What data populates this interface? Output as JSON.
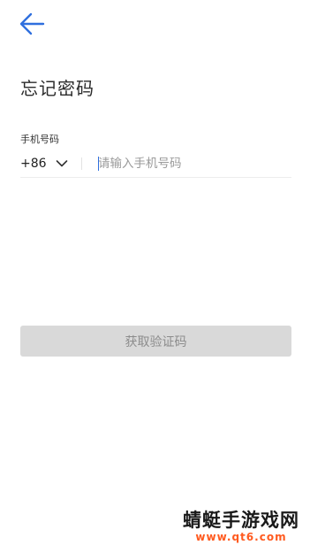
{
  "header": {
    "back_icon": "arrow-left-icon",
    "title": "忘记密码"
  },
  "form": {
    "phone_label": "手机号码",
    "country_code": "+86",
    "country_code_icon": "chevron-down-icon",
    "phone_placeholder": "请输入手机号码",
    "phone_value": ""
  },
  "actions": {
    "get_code_label": "获取验证码"
  },
  "watermark": {
    "title": "蜻蜓手游戏网",
    "url": "www.qt6.com"
  },
  "colors": {
    "accent": "#2f6fde",
    "button_disabled_bg": "#d9d9d9",
    "button_disabled_text": "#8c8c8c",
    "watermark_url": "#ff5a1f"
  }
}
